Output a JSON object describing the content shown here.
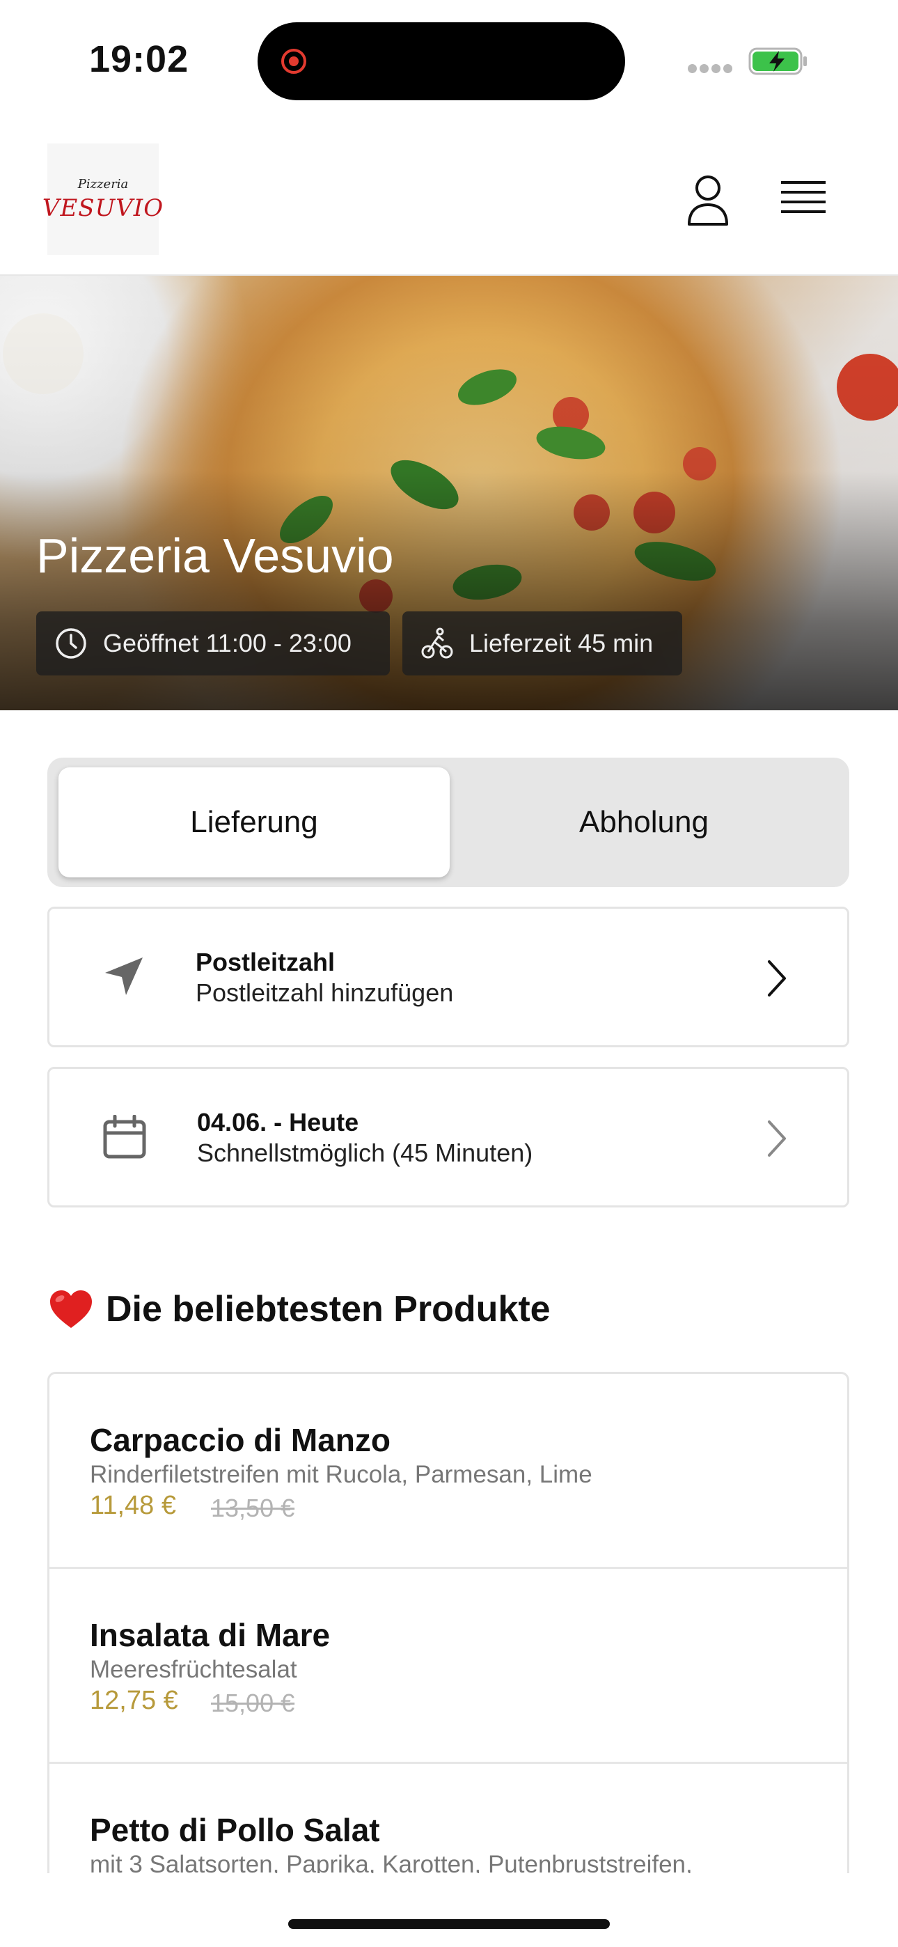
{
  "status_bar": {
    "time": "19:02"
  },
  "header": {
    "logo_line1": "Pizzeria",
    "logo_line2": "VESUVIO"
  },
  "hero": {
    "title": "Pizzeria Vesuvio",
    "opening_hours": "Geöffnet 11:00 - 23:00",
    "delivery_time": "Lieferzeit 45 min"
  },
  "order_type": {
    "options": [
      "Lieferung",
      "Abholung"
    ],
    "selected": "Lieferung"
  },
  "postal_card": {
    "title": "Postleitzahl",
    "subtitle": "Postleitzahl hinzufügen"
  },
  "date_card": {
    "title": "04.06. - Heute",
    "subtitle": "Schnellstmöglich (45 Minuten)"
  },
  "popular": {
    "heading": "Die beliebtesten Produkte",
    "products": [
      {
        "name": "Carpaccio di Manzo",
        "description": "Rinderfiletstreifen mit Rucola, Parmesan, Lime",
        "price": "11,48 €",
        "old_price": "13,50 €"
      },
      {
        "name": "Insalata di Mare",
        "description": "Meeresfrüchtesalat",
        "price": "12,75 €",
        "old_price": "15,00 €"
      },
      {
        "name": "Petto di Pollo Salat",
        "description": "mit 3 Salatsorten, Paprika, Karotten, Putenbruststreifen,",
        "price": "",
        "old_price": ""
      }
    ]
  },
  "colors": {
    "price_gold": "#b79a3b",
    "heart_red": "#e02020",
    "battery_green": "#3cc24a"
  },
  "icons": [
    "user-icon",
    "menu-icon",
    "clock-icon",
    "bike-icon",
    "location-arrow-icon",
    "calendar-icon",
    "chevron-right-icon",
    "heart-icon"
  ]
}
